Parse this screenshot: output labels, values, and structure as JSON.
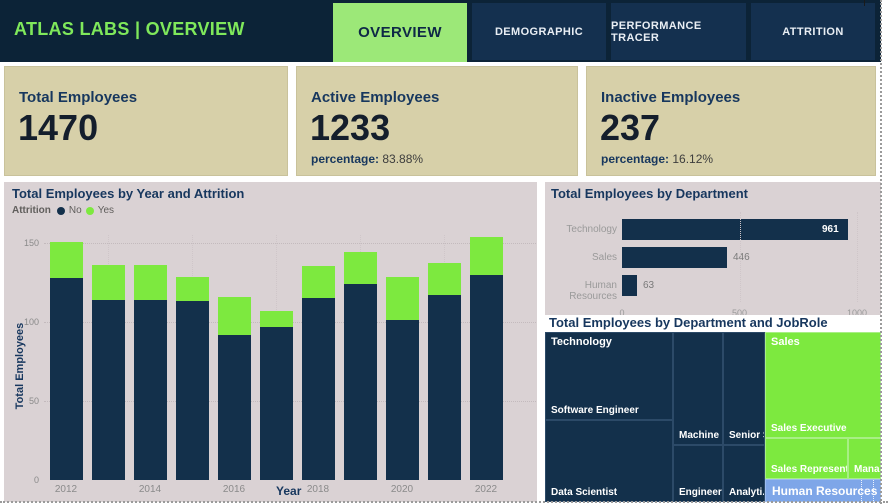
{
  "header": {
    "title": "ATLAS LABS | OVERVIEW",
    "tabs": [
      {
        "label": "OVERVIEW",
        "active": true
      },
      {
        "label": "DEMOGRAPHIC",
        "active": false
      },
      {
        "label": "PERFORMANCE TRACER",
        "active": false
      },
      {
        "label": "ATTRITION",
        "active": false
      }
    ]
  },
  "cards": [
    {
      "title": "Total Employees",
      "value": "1470"
    },
    {
      "title": "Active Employees",
      "value": "1233",
      "subtitle_label": "percentage:",
      "subtitle_value": "83.88%"
    },
    {
      "title": "Inactive Employees",
      "value": "237",
      "subtitle_label": "percentage:",
      "subtitle_value": "16.12%"
    }
  ],
  "colors": {
    "header_navy": "#0C2337",
    "tab_navy": "#14304F",
    "tab_green": "#9CE878",
    "title_green": "#7FE85B",
    "bar_navy": "#13304B",
    "bar_green": "#7DE93F",
    "hr_blue": "#7EA6E8",
    "card_beige": "#D7D0A9",
    "panel_pink_gray": "#DAD2D4",
    "theme_text_navy": "#17375E"
  },
  "chart_data": [
    {
      "type": "bar",
      "stacked": true,
      "title": "Total Employees by Year and Attrition",
      "legend_title": "Attrition",
      "legend_position": "top-left",
      "categories": [
        "2012",
        "2013",
        "2014",
        "2015",
        "2016",
        "2017",
        "2018",
        "2019",
        "2020",
        "2021",
        "2022"
      ],
      "series": [
        {
          "name": "No",
          "color": "#13304B",
          "values": [
            128,
            114,
            114,
            113,
            92,
            97,
            115,
            124,
            101,
            117,
            130
          ]
        },
        {
          "name": "Yes",
          "color": "#7DE93F",
          "values": [
            23,
            22,
            22,
            15,
            24,
            10,
            20,
            20,
            27,
            20,
            24
          ]
        }
      ],
      "x_tick_labels": [
        "2012",
        "2014",
        "2016",
        "2018",
        "2020",
        "2022"
      ],
      "xlabel": "Year",
      "ylabel": "Total Employees",
      "yticks": [
        0,
        50,
        100,
        150
      ],
      "ylim": [
        0,
        155
      ],
      "grid": "dotted"
    },
    {
      "type": "bar",
      "orientation": "horizontal",
      "title": "Total Employees by Department",
      "categories": [
        "Technology",
        "Sales",
        "Human Resources"
      ],
      "values": [
        961,
        446,
        63
      ],
      "xticks": [
        0,
        500,
        1000
      ],
      "xlim": [
        0,
        1000
      ],
      "grid": "dotted"
    },
    {
      "type": "treemap",
      "title": "Total Employees by Department and JobRole",
      "cells": [
        {
          "id": "software-engineer",
          "group": "Technology",
          "header": "Technology",
          "label": "Software Engineer"
        },
        {
          "id": "data-scientist",
          "group": "Technology",
          "label": "Data Scientist"
        },
        {
          "id": "machine-learning",
          "group": "Technology",
          "label": "Machine ..."
        },
        {
          "id": "senior-software",
          "group": "Technology",
          "label": "Senior S..."
        },
        {
          "id": "engineering-manager",
          "group": "Technology",
          "label": "Engineerin..."
        },
        {
          "id": "analytics",
          "group": "Technology",
          "label": "Analyti..."
        },
        {
          "id": "sales-executive",
          "group": "Sales",
          "header": "Sales",
          "label": "Sales Executive"
        },
        {
          "id": "sales-representative",
          "group": "Sales",
          "label": "Sales Representati..."
        },
        {
          "id": "manager",
          "group": "Sales",
          "label": "Mana..."
        },
        {
          "id": "human-resources",
          "group": "Human Resources",
          "label": "Human Resources"
        }
      ]
    }
  ]
}
